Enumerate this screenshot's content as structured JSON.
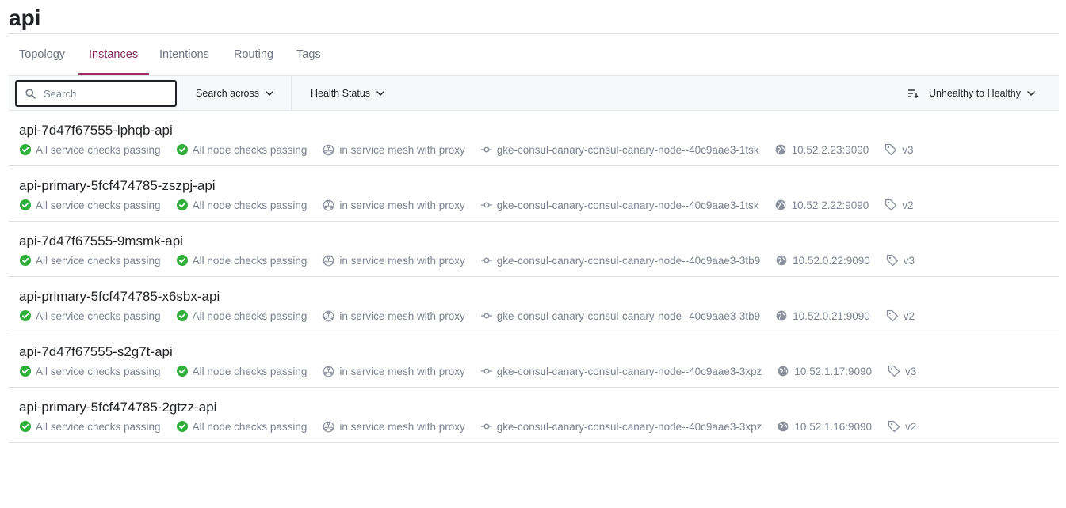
{
  "page": {
    "title": "api"
  },
  "tabs": [
    {
      "label": "Topology"
    },
    {
      "label": "Instances"
    },
    {
      "label": "Intentions"
    },
    {
      "label": "Routing"
    },
    {
      "label": "Tags"
    }
  ],
  "toolbar": {
    "search_placeholder": "Search",
    "search_value": "",
    "search_across_label": "Search across",
    "health_status_label": "Health Status",
    "sort_label": "Unhealthy to Healthy"
  },
  "colors": {
    "accent": "#9b2a62",
    "passing": "#2eb039",
    "muted": "#7c8290"
  },
  "instances": [
    {
      "name": "api-7d47f67555-lphqb-api",
      "service_checks": "All service checks passing",
      "node_checks": "All node checks passing",
      "mesh": "in service mesh with proxy",
      "node": "gke-consul-canary-consul-canary-node--40c9aae3-1tsk",
      "address": "10.52.2.23:9090",
      "tag": "v3"
    },
    {
      "name": "api-primary-5fcf474785-zszpj-api",
      "service_checks": "All service checks passing",
      "node_checks": "All node checks passing",
      "mesh": "in service mesh with proxy",
      "node": "gke-consul-canary-consul-canary-node--40c9aae3-1tsk",
      "address": "10.52.2.22:9090",
      "tag": "v2"
    },
    {
      "name": "api-7d47f67555-9msmk-api",
      "service_checks": "All service checks passing",
      "node_checks": "All node checks passing",
      "mesh": "in service mesh with proxy",
      "node": "gke-consul-canary-consul-canary-node--40c9aae3-3tb9",
      "address": "10.52.0.22:9090",
      "tag": "v3"
    },
    {
      "name": "api-primary-5fcf474785-x6sbx-api",
      "service_checks": "All service checks passing",
      "node_checks": "All node checks passing",
      "mesh": "in service mesh with proxy",
      "node": "gke-consul-canary-consul-canary-node--40c9aae3-3tb9",
      "address": "10.52.0.21:9090",
      "tag": "v2"
    },
    {
      "name": "api-7d47f67555-s2g7t-api",
      "service_checks": "All service checks passing",
      "node_checks": "All node checks passing",
      "mesh": "in service mesh with proxy",
      "node": "gke-consul-canary-consul-canary-node--40c9aae3-3xpz",
      "address": "10.52.1.17:9090",
      "tag": "v3"
    },
    {
      "name": "api-primary-5fcf474785-2gtzz-api",
      "service_checks": "All service checks passing",
      "node_checks": "All node checks passing",
      "mesh": "in service mesh with proxy",
      "node": "gke-consul-canary-consul-canary-node--40c9aae3-3xpz",
      "address": "10.52.1.16:9090",
      "tag": "v2"
    }
  ]
}
